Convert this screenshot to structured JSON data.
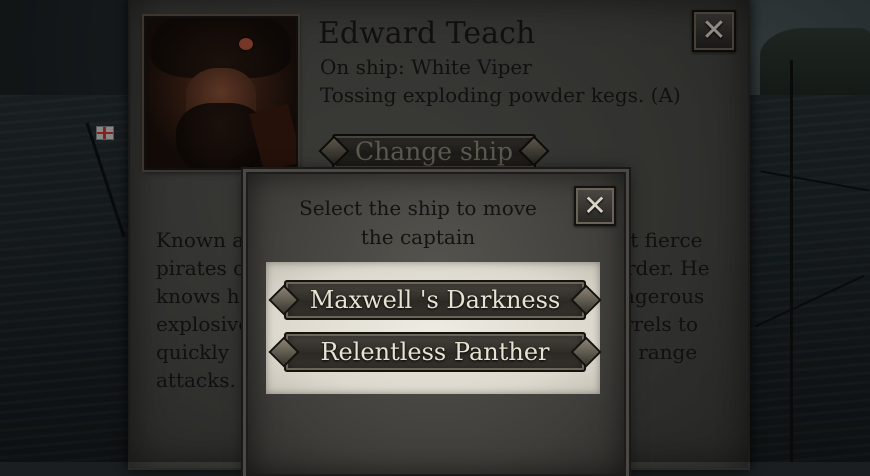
{
  "captain": {
    "name": "Edward Teach",
    "ship_line": "On ship: White Viper",
    "ability_line": "Tossing exploding powder kegs. (A)",
    "change_ship_label": "Change ship",
    "close_symbol": "✕",
    "bio_visible_fragments": [
      "Known a",
      "st fierce",
      "pirates o",
      "rder. He",
      "knows h",
      "ngerous",
      "explosive",
      "rrels to",
      "quickly",
      "e range",
      "attacks."
    ]
  },
  "modal": {
    "title": "Select the ship to move the captain",
    "close_symbol": "✕",
    "ships": [
      {
        "label": "Maxwell 's Darkness"
      },
      {
        "label": "Relentless Panther"
      }
    ]
  },
  "colors": {
    "panel": "#4a4a46",
    "text_dark": "#1b1916",
    "list_bg": "#e6e2d8",
    "button_text": "#e7e2d2"
  },
  "icons": {
    "close": "close-icon",
    "portrait": "pirate-portrait"
  }
}
